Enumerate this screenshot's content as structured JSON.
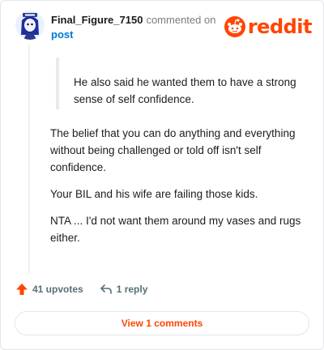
{
  "colors": {
    "brand": "#ff4500",
    "link": "#0079d3",
    "upvote": "#ff4500"
  },
  "header": {
    "username": "Final_Figure_7150",
    "action_text": "commented on",
    "post_link": "post",
    "logo_text": "reddit"
  },
  "comment": {
    "quote": "He also said he wanted them to have a strong sense of self confidence.",
    "paragraphs": [
      "The belief that you can do anything and everything without being challenged or told off isn't self confidence.",
      "Your BIL and his wife are failing those kids.",
      "NTA ... I'd not want them around my vases and rugs either."
    ]
  },
  "actions": {
    "upvotes": "41 upvotes",
    "replies": "1 reply",
    "upvote_icon": "upvote-arrow-icon",
    "reply_icon": "reply-arrow-icon"
  },
  "footer": {
    "view_comments": "View 1 comments"
  }
}
